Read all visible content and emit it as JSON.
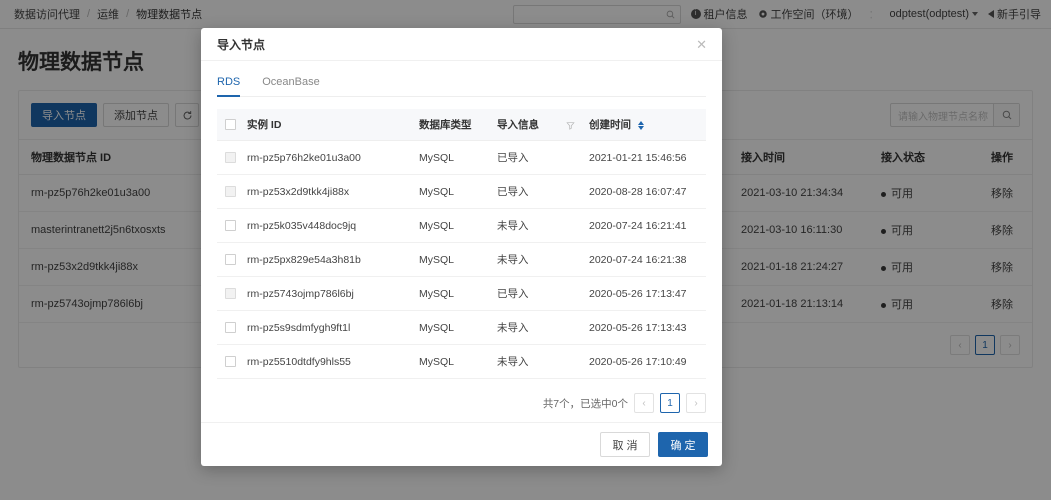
{
  "header": {
    "breadcrumb": [
      "数据访问代理",
      "运维",
      "物理数据节点"
    ],
    "search_placeholder": "",
    "tenant_label": "租户信息",
    "workspace_label": "工作空间（环境）",
    "workspace_value": "odptest(odptest)",
    "guide_label": "新手引导",
    "divider": "：",
    "separator": "/"
  },
  "page": {
    "title": "物理数据节点",
    "toolbar": {
      "import_label": "导入节点",
      "add_label": "添加节点",
      "refresh_icon": "refresh-icon",
      "search_placeholder": "请输入物理节点名称"
    },
    "table": {
      "columns": [
        "物理数据节点 ID",
        "接入时间",
        "接入状态",
        "操作"
      ],
      "rows": [
        {
          "id": "rm-pz5p76h2ke01u3a00",
          "access_time": "2021-03-10 21:34:34",
          "status": "可用",
          "action": "移除"
        },
        {
          "id": "masterintranett2j5n6txosxts",
          "access_time": "2021-03-10 16:11:30",
          "status": "可用",
          "action": "移除"
        },
        {
          "id": "rm-pz53x2d9tkk4ji88x",
          "access_time": "2021-01-18 21:24:27",
          "status": "可用",
          "action": "移除"
        },
        {
          "id": "rm-pz5743ojmp786l6bj",
          "access_time": "2021-01-18 21:13:14",
          "status": "可用",
          "action": "移除"
        }
      ]
    },
    "pagination": {
      "prev": "‹",
      "page": "1",
      "next": "›"
    }
  },
  "modal": {
    "title": "导入节点",
    "close_icon": "close-icon",
    "tabs": [
      {
        "label": "RDS",
        "active": true
      },
      {
        "label": "OceanBase",
        "active": false
      }
    ],
    "table": {
      "columns": [
        "实例 ID",
        "数据库类型",
        "导入信息",
        "创建时间"
      ],
      "filter_icon": "filter-icon",
      "sort_icon": "sort-icon",
      "rows": [
        {
          "id": "rm-pz5p76h2ke01u3a00",
          "db_type": "MySQL",
          "import_info": "已导入",
          "created": "2021-01-21 15:46:56",
          "checkbox_disabled": true
        },
        {
          "id": "rm-pz53x2d9tkk4ji88x",
          "db_type": "MySQL",
          "import_info": "已导入",
          "created": "2020-08-28 16:07:47",
          "checkbox_disabled": true
        },
        {
          "id": "rm-pz5k035v448doc9jq",
          "db_type": "MySQL",
          "import_info": "未导入",
          "created": "2020-07-24 16:21:41",
          "checkbox_disabled": false
        },
        {
          "id": "rm-pz5px829e54a3h81b",
          "db_type": "MySQL",
          "import_info": "未导入",
          "created": "2020-07-24 16:21:38",
          "checkbox_disabled": false
        },
        {
          "id": "rm-pz5743ojmp786l6bj",
          "db_type": "MySQL",
          "import_info": "已导入",
          "created": "2020-05-26 17:13:47",
          "checkbox_disabled": true
        },
        {
          "id": "rm-pz5s9sdmfygh9ft1l",
          "db_type": "MySQL",
          "import_info": "未导入",
          "created": "2020-05-26 17:13:43",
          "checkbox_disabled": false
        },
        {
          "id": "rm-pz5510dtdfy9hls55",
          "db_type": "MySQL",
          "import_info": "未导入",
          "created": "2020-05-26 17:10:49",
          "checkbox_disabled": false
        }
      ]
    },
    "pagination": {
      "summary": "共7个，已选中0个",
      "prev": "‹",
      "page": "1",
      "next": "›"
    },
    "footer": {
      "cancel_label": "取 消",
      "confirm_label": "确 定"
    }
  },
  "colors": {
    "primary": "#1e65ad",
    "link": "#1e65ad",
    "status": "#3a3a3a"
  }
}
